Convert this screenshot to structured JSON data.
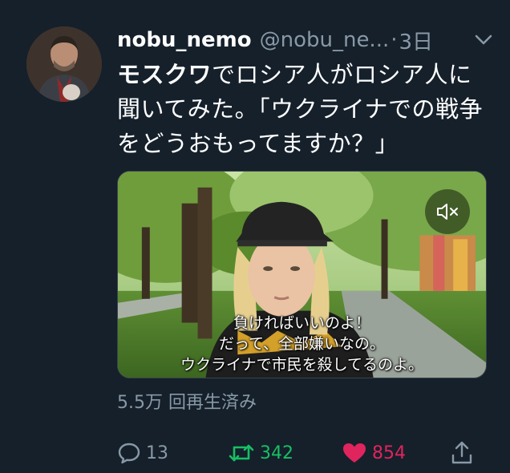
{
  "tweet": {
    "author_name": "nobu_nemo",
    "handle": "@nobu_ne...",
    "separator": "·",
    "time": "3日",
    "text_bold": "モスクワ",
    "text_rest": "でロシア人がロシア人に聞いてみた。「ウクライナでの戦争をどうおもってますか？」",
    "subtitles": [
      "負ければいいのよ！",
      "だって、全部嫌いなの。",
      "ウクライナで市民を殺してるのよ。"
    ],
    "views": "5.5万 回再生済み",
    "reply_count": "13",
    "retweet_count": "342",
    "like_count": "854"
  },
  "icons": {
    "caret": "chevron-down-icon",
    "mute": "speaker-muted-icon",
    "reply": "reply-bubble-icon",
    "retweet": "retweet-icon",
    "like": "heart-icon",
    "share": "share-icon"
  },
  "colors": {
    "background": "#15202b",
    "secondary_text": "#8899a6",
    "retweet_green": "#17bf63",
    "like_pink": "#e0245e"
  }
}
